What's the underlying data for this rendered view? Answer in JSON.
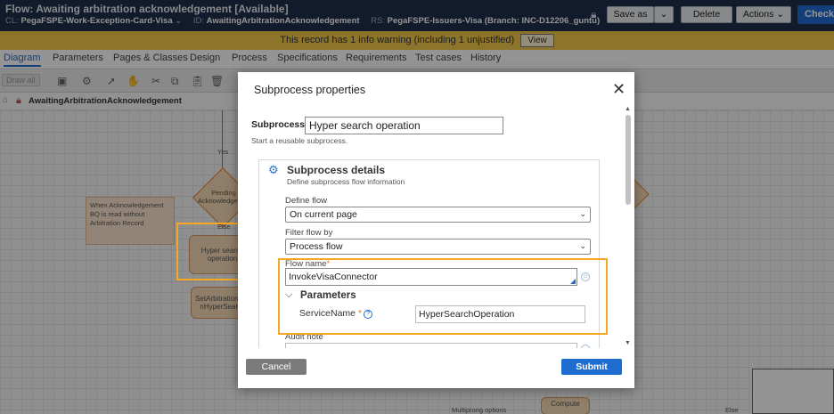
{
  "header": {
    "title": "Flow: Awaiting arbitration acknowledgement [Available]",
    "cl_key": "CL:",
    "cl_value": "PegaFSPE-Work-Exception-Card-Visa",
    "id_key": "ID:",
    "id_value": "AwaitingArbitrationAcknowledgement",
    "rs_key": "RS:",
    "rs_value": "PegaFSPE-Issuers-Visa (Branch: INC-D12206_guntu)",
    "save_as": "Save as",
    "delete": "Delete",
    "actions": "Actions",
    "check": "Check o"
  },
  "warning": {
    "text": "This record has 1 info warning (including 1 unjustified)",
    "view": "View"
  },
  "tabs": [
    "Diagram",
    "Parameters",
    "Pages & Classes",
    "Design",
    "Process",
    "Specifications",
    "Requirements",
    "Test cases",
    "History"
  ],
  "toolbar": {
    "draw_label": "Draw all"
  },
  "breadcrumb": {
    "name": "AwaitingArbitrationAcknowledgement"
  },
  "canvas": {
    "yes_label": "Yes",
    "pending_label": "Pending Acknowledgeme...",
    "else_label": "Else",
    "note_text": "When Acknowledgement BQ is read without Arbitration Record",
    "hyper_node": "Hyper search operation",
    "setarb_node": "SetArbitrationIn... nHyperSearch",
    "multiprong": "Multiprong options",
    "compute": "Compute",
    "else2": "Else"
  },
  "modal": {
    "title": "Subprocess properties",
    "subprocess_label": "Subprocess:",
    "subprocess_value": "Hyper search operation",
    "subprocess_help": "Start a reusable subprocess.",
    "details_title": "Subprocess details",
    "details_sub": "Define subprocess flow information",
    "define_flow_label": "Define flow",
    "define_flow_value": "On current page",
    "filter_flow_label": "Filter flow by",
    "filter_flow_value": "Process flow",
    "flow_name_label": "Flow name",
    "flow_name_value": "InvokeVisaConnector",
    "parameters_title": "Parameters",
    "service_name_label": "ServiceName",
    "service_name_value": "HyperSearchOperation",
    "audit_label": "Audit note",
    "cancel": "Cancel",
    "submit": "Submit"
  },
  "colors": {
    "accent": "#1f6cd1",
    "highlight": "#f5a623",
    "header_bg": "#1f2f4a",
    "warning_bg": "#f3c84b"
  }
}
